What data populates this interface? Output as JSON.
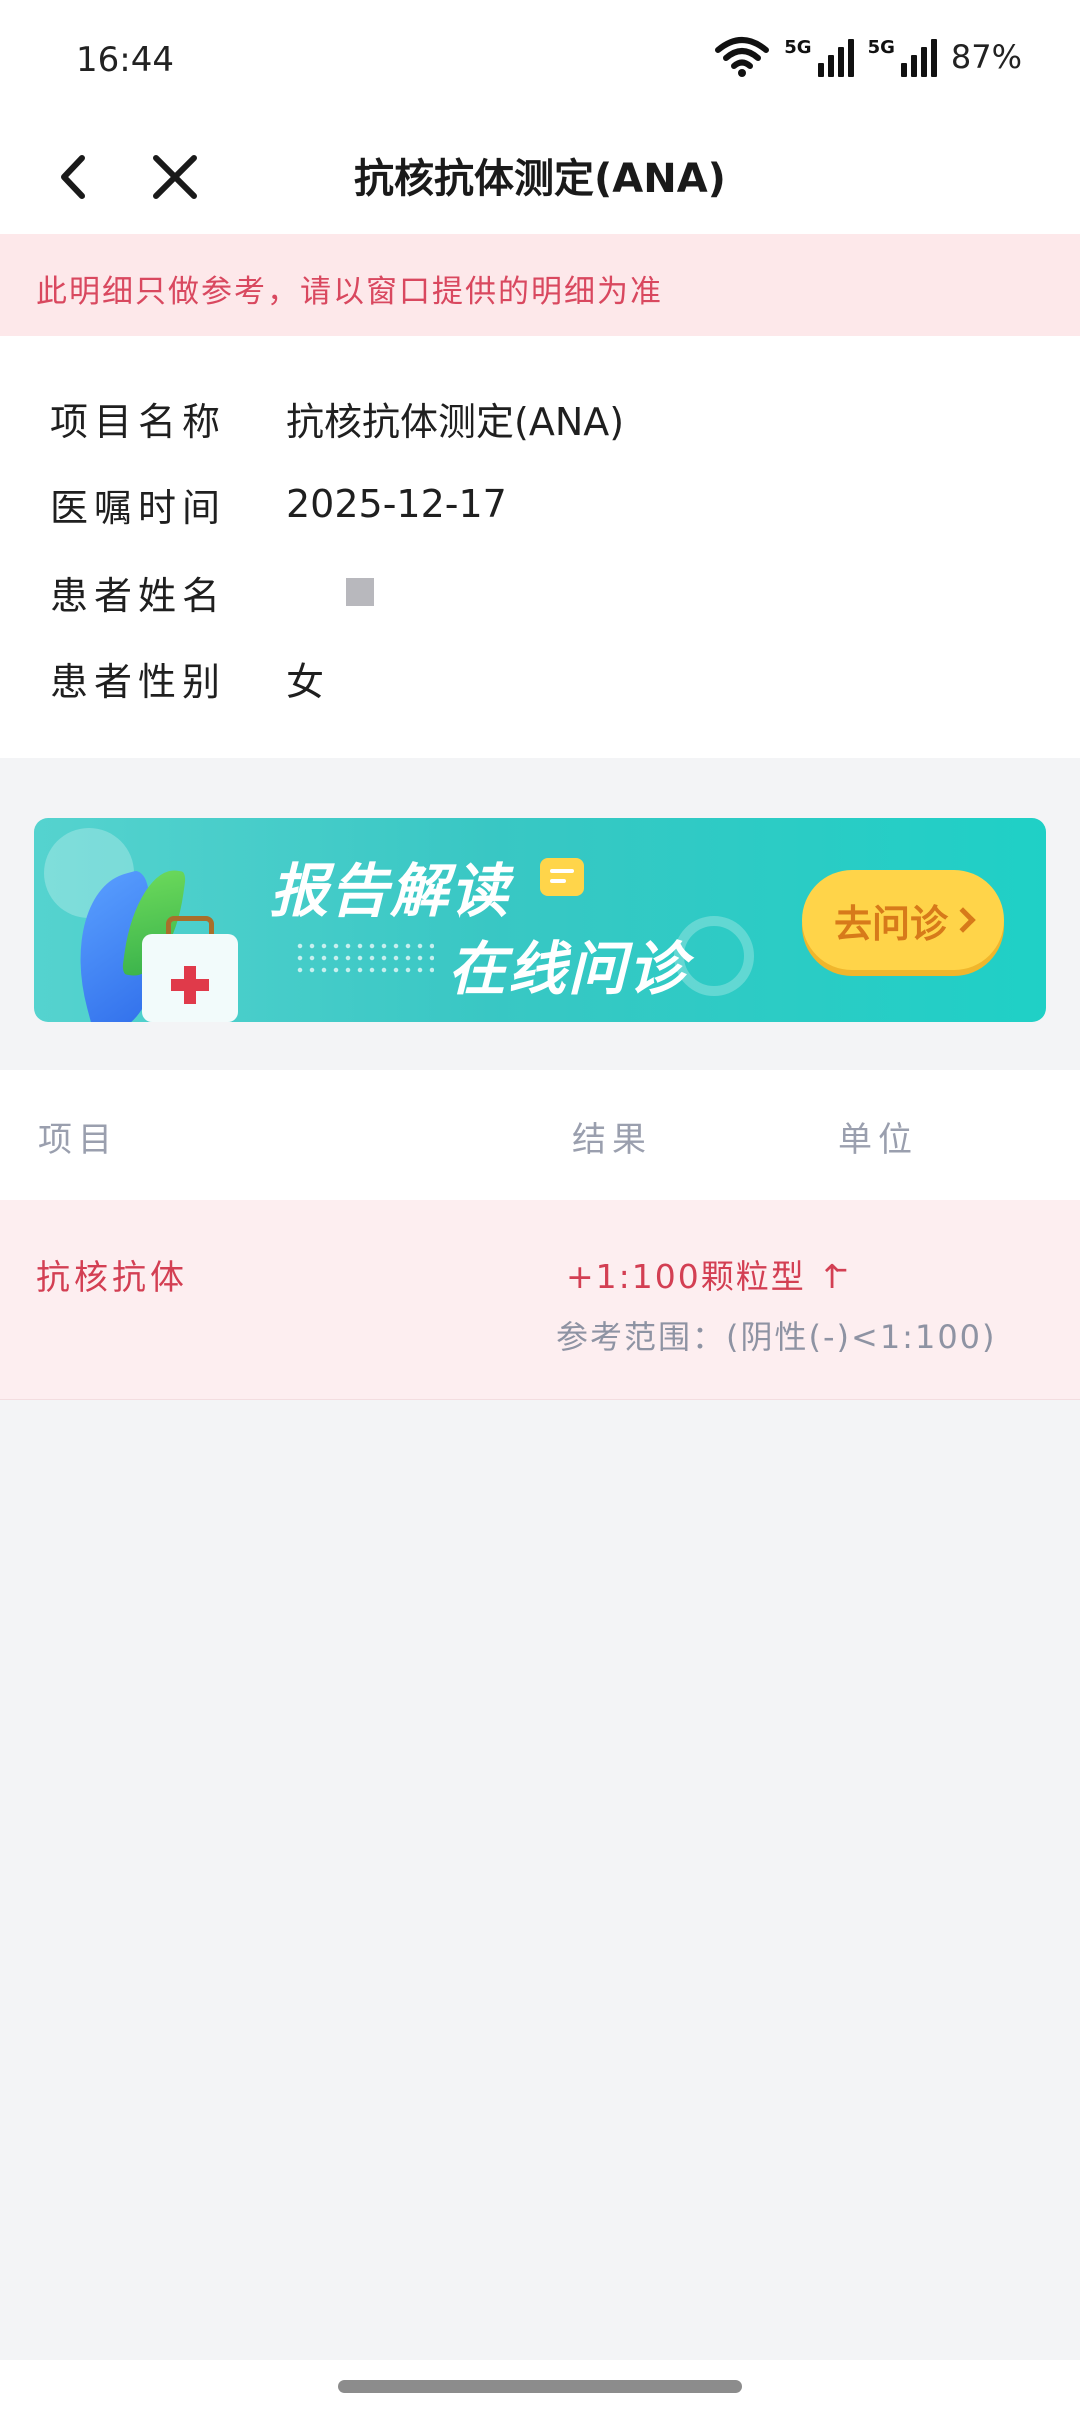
{
  "status_bar": {
    "time": "16:44",
    "network1": "5G",
    "network2": "5G",
    "battery": "87%"
  },
  "nav": {
    "title": "抗核抗体测定(ANA)",
    "back_icon": "chevron-left-icon",
    "close_icon": "close-icon"
  },
  "notice": {
    "text": "此明细只做参考，请以窗口提供的明细为准"
  },
  "info": {
    "rows": [
      {
        "label": "项目名称",
        "value": "抗核抗体测定(ANA)"
      },
      {
        "label": "医嘱时间",
        "value": "2025-12-17"
      },
      {
        "label": "患者姓名",
        "value": ""
      },
      {
        "label": "患者性别",
        "value": "女"
      }
    ]
  },
  "banner": {
    "title1": "报告解读",
    "title2": "在线问诊",
    "cta_label": "去问诊"
  },
  "table": {
    "headers": {
      "item": "项目",
      "result": "结果",
      "unit": "单位"
    },
    "rows": [
      {
        "item": "抗核抗体",
        "result": "+1:100颗粒型 ↑",
        "unit": "-",
        "reference": "参考范围：(阴性(-)<1:100)"
      }
    ]
  },
  "colors": {
    "accent_red": "#d33f53",
    "notice_bg": "#fde8ea",
    "banner_teal": "#39c7c4",
    "cta_yellow": "#ffd449"
  }
}
